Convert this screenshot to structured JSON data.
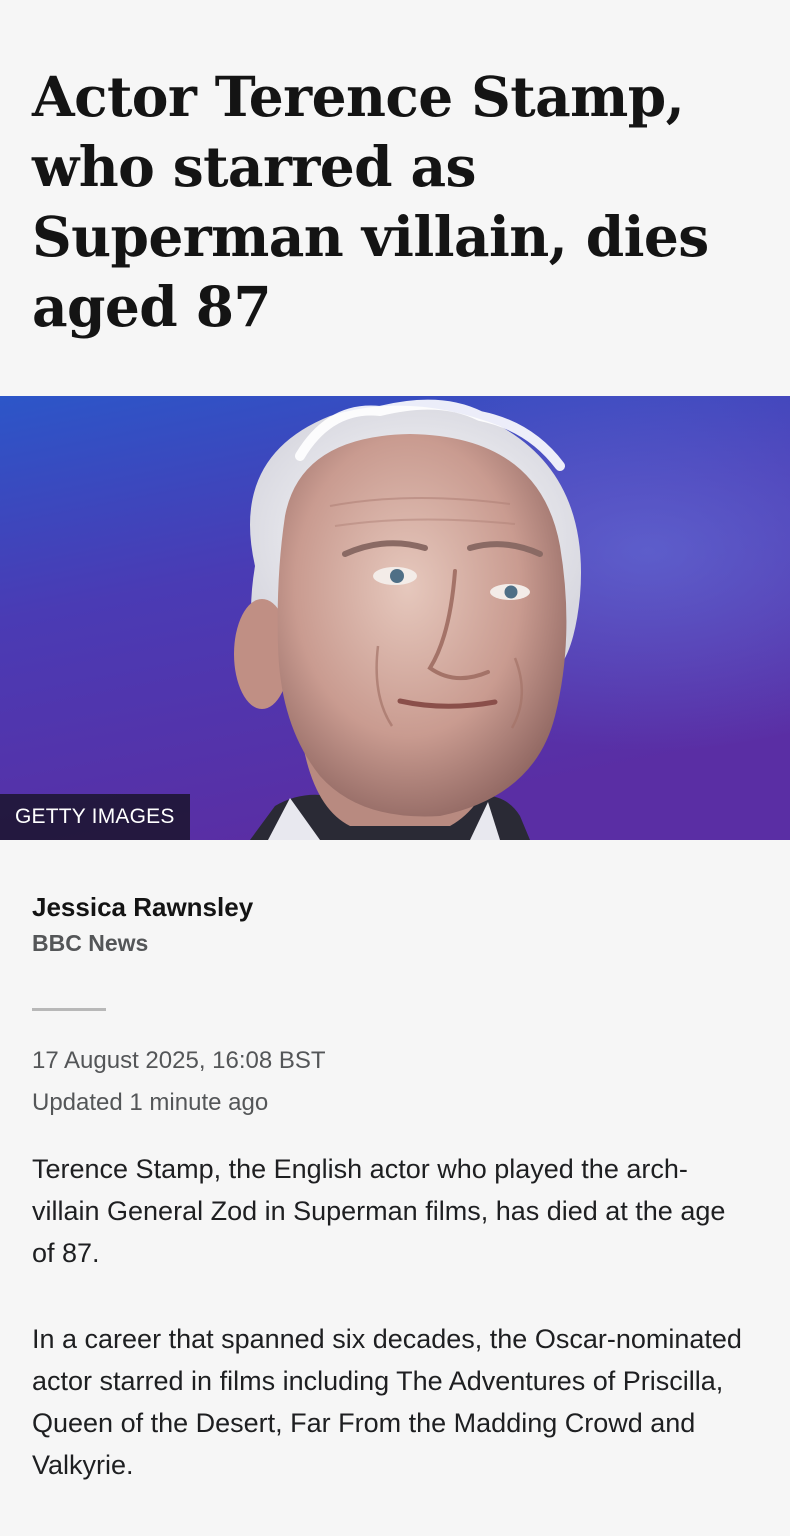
{
  "article": {
    "headline": "Actor Terence Stamp, who starred as Superman villain, dies aged 87",
    "image": {
      "subject": "portrait-photo",
      "credit": "GETTY IMAGES"
    },
    "byline": {
      "author": "Jessica Rawnsley",
      "outlet": "BBC News"
    },
    "published": "17 August 2025, 16:08 BST",
    "updated": "Updated 1 minute ago",
    "paragraphs": [
      "Terence Stamp, the English actor who played the arch-villain General Zod in Superman films, has died at the age of 87.",
      "In a career that spanned six decades, the Oscar-nominated actor starred in films including The Adventures of Priscilla, Queen of the Desert, Far From the Madding Crowd and Valkyrie."
    ]
  },
  "colors": {
    "background": "#f6f6f6",
    "headline": "#141414",
    "meta": "#545658",
    "hero_backdrop_top": "#2b4fc0",
    "hero_backdrop_bottom": "#5a2fa8"
  }
}
